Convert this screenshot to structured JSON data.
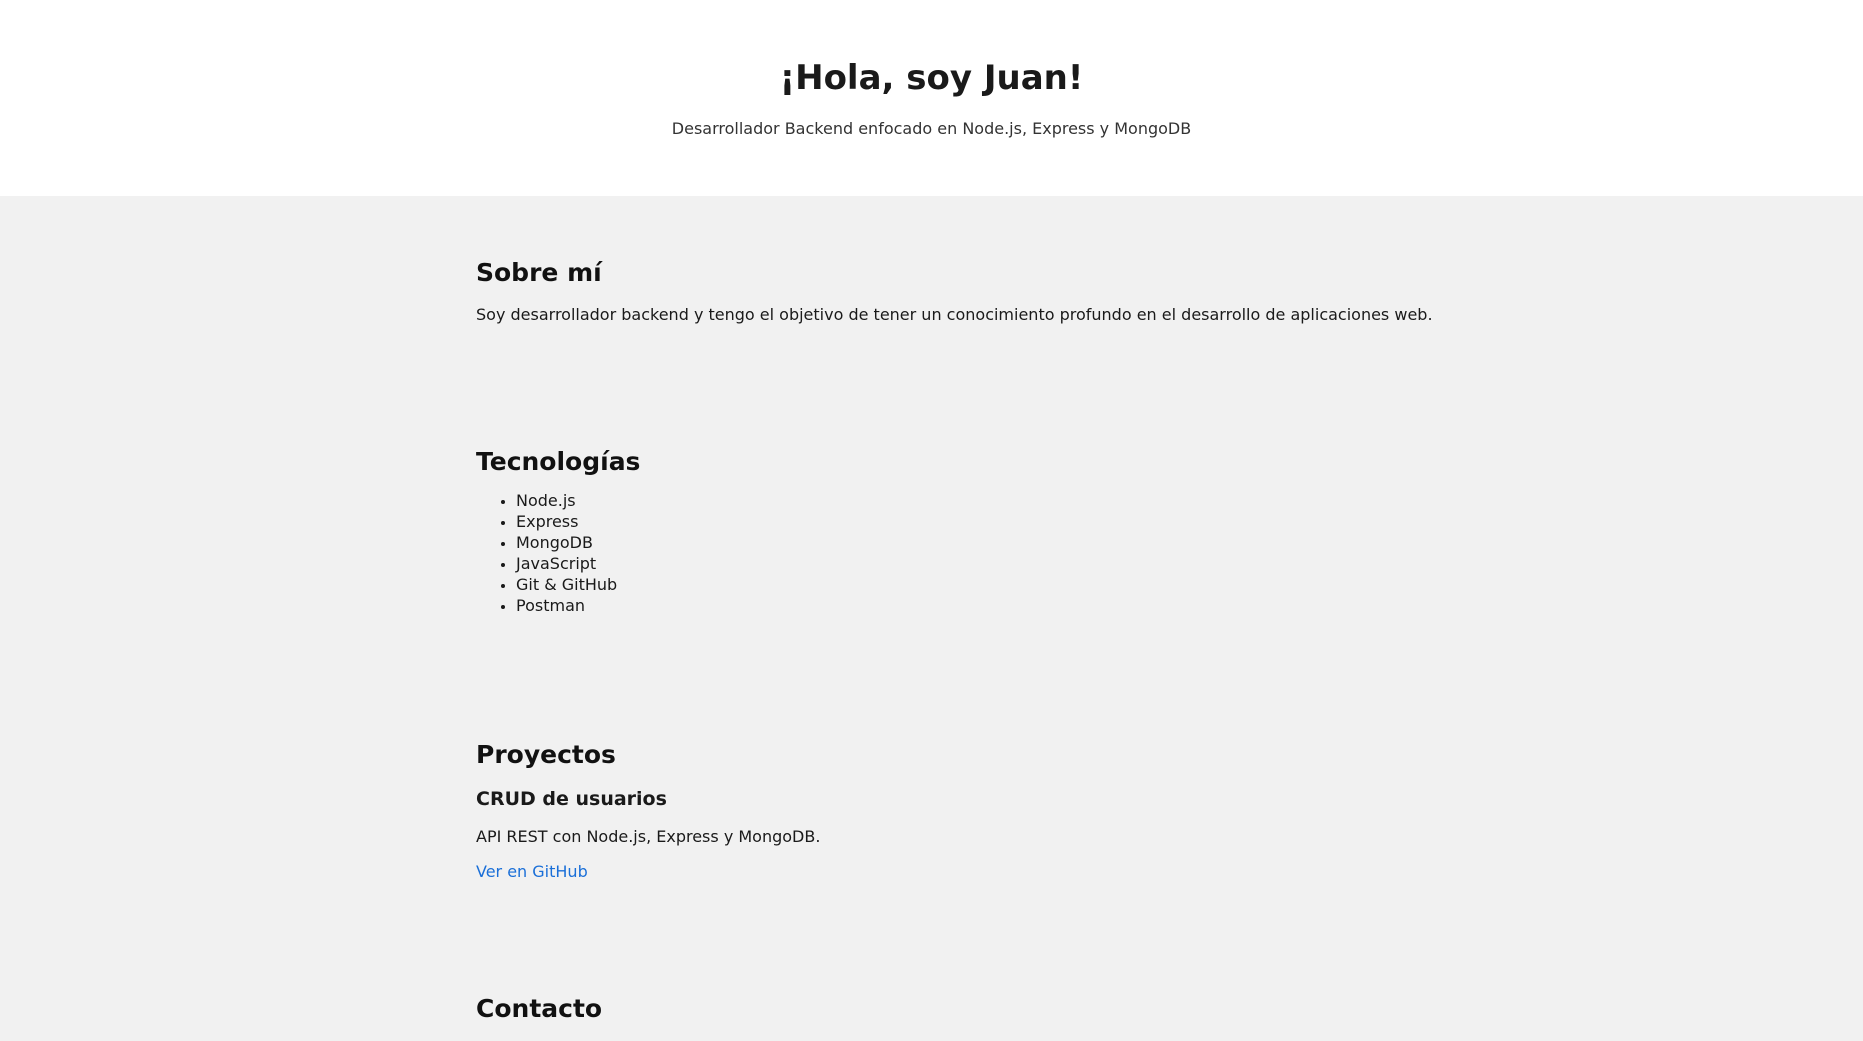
{
  "hero": {
    "title": "¡Hola, soy Juan!",
    "subtitle": "Desarrollador Backend enfocado en Node.js, Express y MongoDB"
  },
  "about": {
    "heading": "Sobre mí",
    "text": "Soy desarrollador backend y tengo el objetivo de tener un conocimiento profundo en el desarrollo de aplicaciones web."
  },
  "tech": {
    "heading": "Tecnologías",
    "items": [
      "Node.js",
      "Express",
      "MongoDB",
      "JavaScript",
      "Git & GitHub",
      "Postman"
    ]
  },
  "projects": {
    "heading": "Proyectos",
    "items": [
      {
        "title": "CRUD de usuarios",
        "description": "API REST con Node.js, Express y MongoDB.",
        "link_label": "Ver en GitHub"
      }
    ]
  },
  "contact": {
    "heading": "Contacto"
  },
  "colors": {
    "link": "#1a6fd8",
    "hero_bg": "#ffffff",
    "page_bg": "#f1f1f1"
  }
}
